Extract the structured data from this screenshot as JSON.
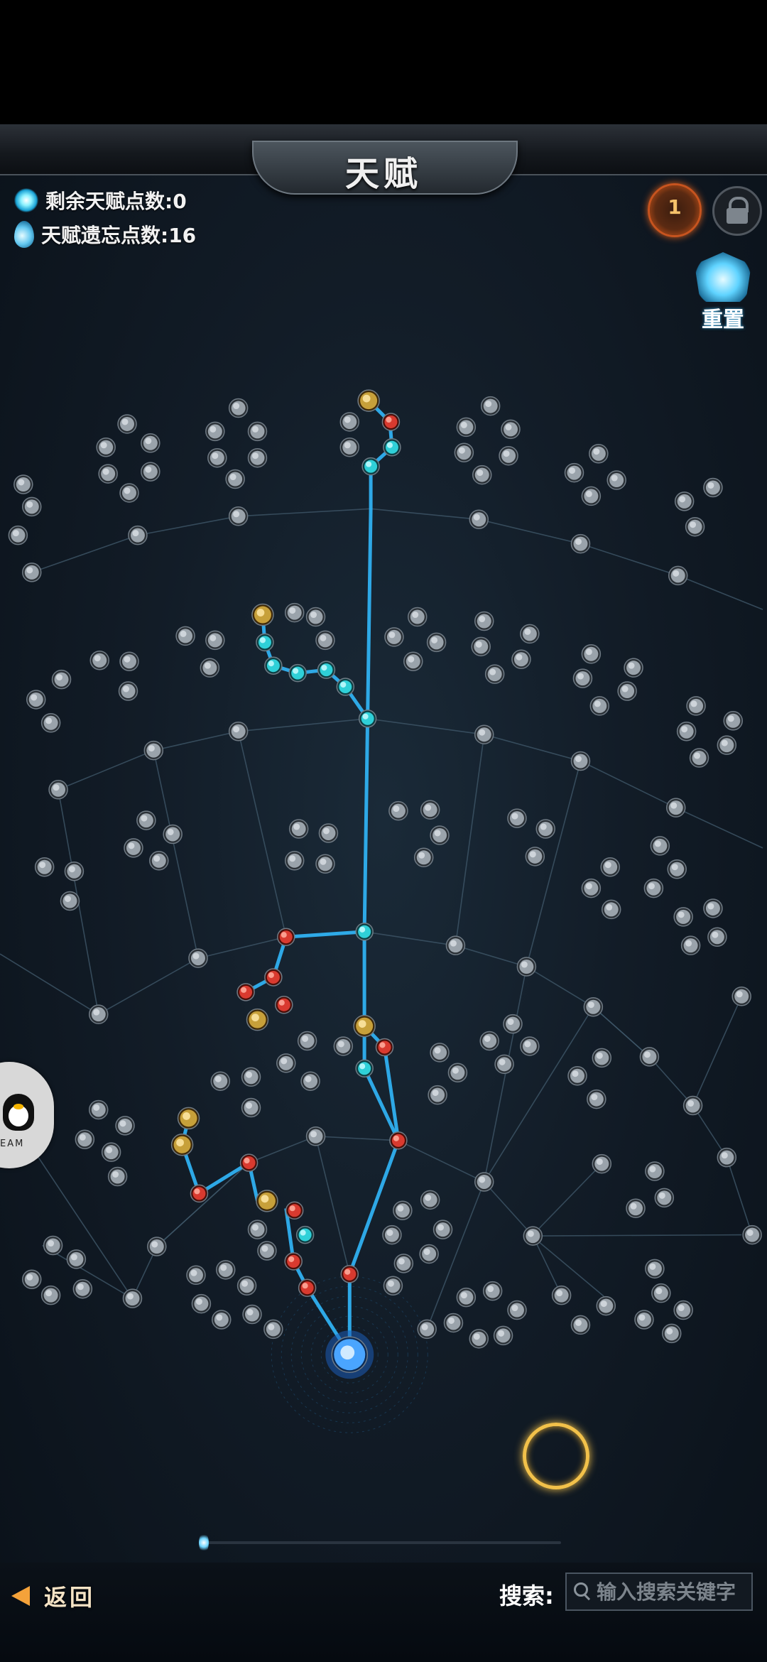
{
  "header": {
    "title": "天赋"
  },
  "stats": {
    "remaining_points_label": "剩余天赋点数:0",
    "forget_points_label": "天赋遗忘点数:16"
  },
  "top_right": {
    "ring_icon": "ember-ring-icon",
    "ring_digit": "1",
    "lock_icon": "lock-icon"
  },
  "reset": {
    "label": "重置"
  },
  "floating_widget": {
    "text": "EAM"
  },
  "bottom": {
    "back_label": "返回",
    "search_label": "搜索:",
    "search_placeholder": "输入搜索关键字"
  },
  "colors": {
    "active_link": "#2fb0f0",
    "inactive_link": "#3f5668",
    "node_inactive": "#9aa3ab",
    "node_red": "#d93a2f",
    "node_cyan": "#2fd0d8",
    "node_gold": "#c7a03a",
    "selection_ring": "#f2c14a"
  }
}
